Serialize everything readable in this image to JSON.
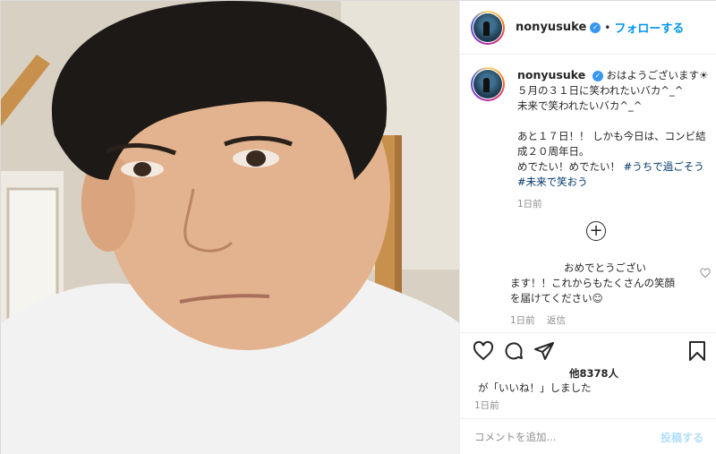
{
  "post": {
    "username": "nonyusuke",
    "verified": true,
    "follow_label": "フォローする",
    "dot": "•"
  },
  "caption": {
    "username": "nonyusuke",
    "lines": [
      "おはようございます☀",
      "５月の３１日に笑われたいバカ^_^",
      "未来で笑われたいバカ^_^",
      "",
      "あと１７日！！ しかも今日は、コンビ結",
      "成２０周年日。",
      "めでたい！めでたい！"
    ],
    "hashtags": [
      "#うちで過ごそう",
      "#未来で笑おう"
    ],
    "time": "1日前"
  },
  "load_more_label": "+",
  "reply": {
    "line1": "おめでとうござい",
    "line2": "ます！！これからもたくさんの笑顔",
    "line3": "を届けてください☺",
    "time": "1日前",
    "reply_label": "返信"
  },
  "likes": {
    "count": "他8378人",
    "liked_by_text": "が「いいね！」しました",
    "date": "1日前"
  },
  "comment_box": {
    "placeholder": "コメントを追加...",
    "post_label": "投稿する"
  },
  "icons": {
    "heart": "heart-icon",
    "comment": "comment-icon",
    "share": "paper-plane-icon",
    "save": "bookmark-icon",
    "verified": "verified-badge-icon",
    "plus": "plus-circle-icon"
  },
  "colors": {
    "accent": "#0095f6",
    "muted": "#8e8e8e",
    "verified": "#3897f0",
    "post_disabled": "#b2dffc"
  }
}
